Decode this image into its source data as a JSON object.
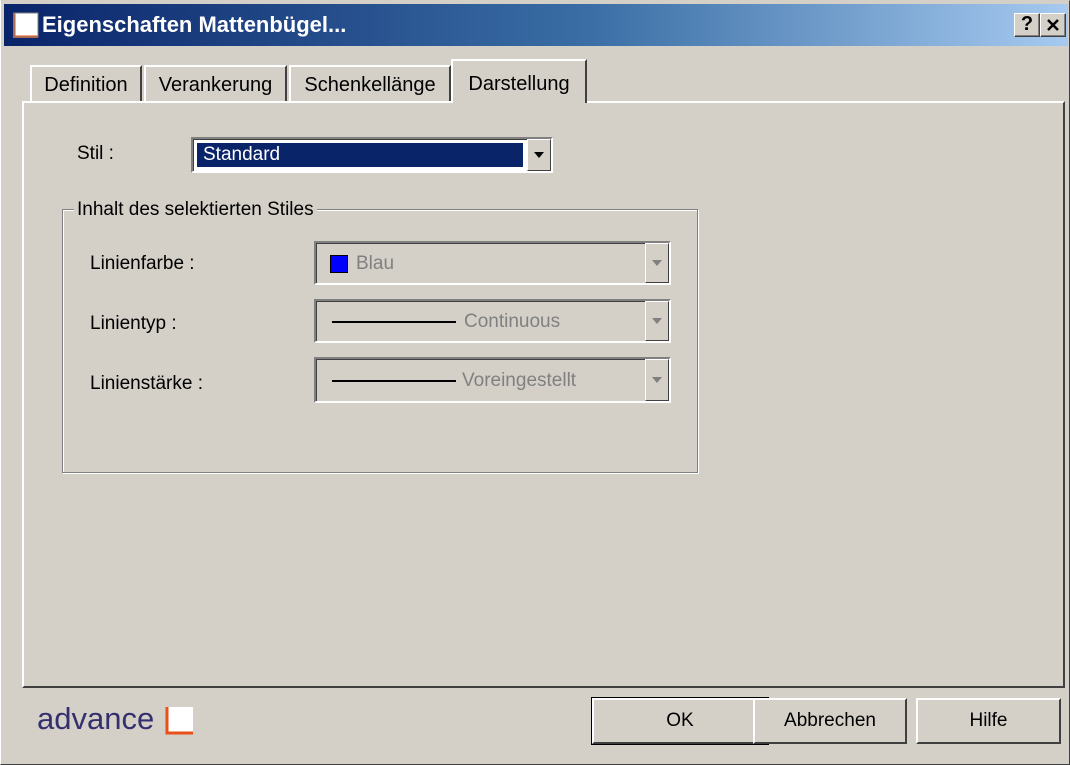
{
  "window": {
    "title": "Eigenschaften Mattenbügel...",
    "help_button": "?",
    "close_button": "✕"
  },
  "tabs": [
    {
      "label": "Definition"
    },
    {
      "label": "Verankerung"
    },
    {
      "label": "Schenkellänge"
    },
    {
      "label": "Darstellung"
    }
  ],
  "active_tab": "Darstellung",
  "style": {
    "label": "Stil :",
    "value": "Standard"
  },
  "group": {
    "title": "Inhalt des selektierten Stiles"
  },
  "line_color": {
    "label": "Linienfarbe :",
    "value": "Blau",
    "swatch_color": "#0000ff"
  },
  "line_type": {
    "label": "Linientyp :",
    "value": "Continuous"
  },
  "line_weight": {
    "label": "Linienstärke :",
    "value": "Voreingestellt"
  },
  "buttons": {
    "ok": "OK",
    "cancel": "Abbrechen",
    "help": "Hilfe"
  },
  "brand": {
    "text": "advance"
  }
}
